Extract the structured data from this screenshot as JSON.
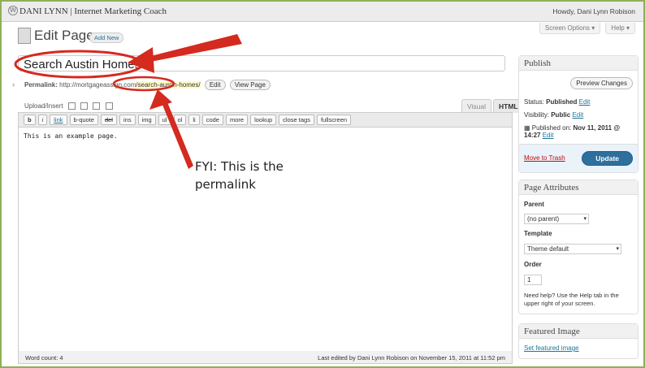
{
  "topbar": {
    "site_name": "DANI LYNN | Internet Marketing Coach",
    "howdy": "Howdy, Dani Lynn Robison"
  },
  "screen_options": {
    "screen_options_label": "Screen Options ▾",
    "help_label": "Help ▾"
  },
  "heading": {
    "title": "Edit Page",
    "add_new": "Add New"
  },
  "post": {
    "title_value": "Search Austin Homes",
    "permalink_label": "Permalink:",
    "permalink_base": "http://mortgageassign.co",
    "permalink_hidden": "m",
    "permalink_slug": "/search-austin-homes/",
    "edit_label": "Edit",
    "view_page_label": "View Page"
  },
  "editor": {
    "upload_insert": "Upload/Insert",
    "tabs": [
      "Visual",
      "HTML"
    ],
    "quicktags": [
      "b",
      "i",
      "link",
      "b-quote",
      "del",
      "ins",
      "img",
      "ul",
      "ol",
      "li",
      "code",
      "more",
      "lookup",
      "close tags",
      "fullscreen"
    ],
    "content": "This is an example page.",
    "word_count": "Word count: 4",
    "last_edited": "Last edited by Dani Lynn Robison on November 15, 2011 at 11:52 pm"
  },
  "publish": {
    "title": "Publish",
    "preview_changes": "Preview Changes",
    "status_label": "Status:",
    "status_value": "Published",
    "visibility_label": "Visibility:",
    "visibility_value": "Public",
    "published_on_label": "Published on:",
    "published_on_value": "Nov 11, 2011 @ 14:27",
    "edit_link": "Edit",
    "move_to_trash": "Move to Trash",
    "update": "Update"
  },
  "page_attributes": {
    "title": "Page Attributes",
    "parent_label": "Parent",
    "parent_value": "(no parent)",
    "template_label": "Template",
    "template_value": "Theme default",
    "order_label": "Order",
    "order_value": "1",
    "help_text": "Need help? Use the Help tab in the upper right of your screen."
  },
  "featured_image": {
    "title": "Featured Image",
    "set_link": "Set featured image"
  },
  "annotation": {
    "line1": "FYI:  This is the",
    "line2": "permalink"
  },
  "colors": {
    "frame": "#8fb054",
    "arrow": "#d42a1f",
    "link": "#21759b",
    "update_button": "#2e6f9e"
  }
}
